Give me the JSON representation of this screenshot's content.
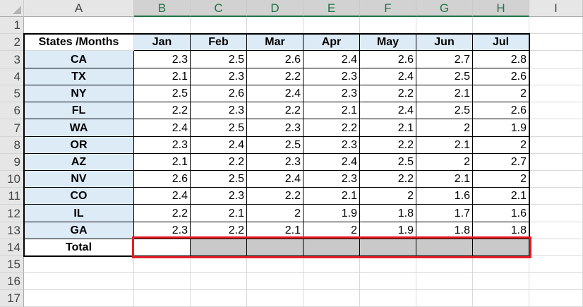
{
  "columns": [
    "A",
    "B",
    "C",
    "D",
    "E",
    "F",
    "G",
    "H",
    "I"
  ],
  "selected_columns": [
    "B",
    "C",
    "D",
    "E",
    "F",
    "G",
    "H"
  ],
  "rows": [
    "1",
    "2",
    "3",
    "4",
    "5",
    "6",
    "7",
    "8",
    "9",
    "10",
    "11",
    "12",
    "13",
    "14",
    "15",
    "16",
    "17"
  ],
  "table": {
    "corner_label": "States /Months",
    "months": [
      "Jan",
      "Feb",
      "Mar",
      "Apr",
      "May",
      "Jun",
      "Jul"
    ],
    "states": [
      "CA",
      "TX",
      "NY",
      "FL",
      "WA",
      "OR",
      "AZ",
      "NV",
      "CO",
      "IL",
      "GA"
    ],
    "values": [
      [
        "2.3",
        "2.5",
        "2.6",
        "2.4",
        "2.6",
        "2.7",
        "2.8"
      ],
      [
        "2.1",
        "2.3",
        "2.2",
        "2.3",
        "2.4",
        "2.5",
        "2.6"
      ],
      [
        "2.5",
        "2.6",
        "2.4",
        "2.3",
        "2.2",
        "2.1",
        "2"
      ],
      [
        "2.2",
        "2.3",
        "2.2",
        "2.1",
        "2.4",
        "2.5",
        "2.6"
      ],
      [
        "2.4",
        "2.5",
        "2.3",
        "2.2",
        "2.1",
        "2",
        "1.9"
      ],
      [
        "2.3",
        "2.4",
        "2.5",
        "2.3",
        "2.2",
        "2.1",
        "2"
      ],
      [
        "2.1",
        "2.2",
        "2.3",
        "2.4",
        "2.5",
        "2",
        "2.7"
      ],
      [
        "2.6",
        "2.5",
        "2.4",
        "2.3",
        "2.2",
        "2.1",
        "2"
      ],
      [
        "2.4",
        "2.3",
        "2.2",
        "2.1",
        "2",
        "1.6",
        "2.1"
      ],
      [
        "2.2",
        "2.1",
        "2",
        "1.9",
        "1.8",
        "1.7",
        "1.6"
      ],
      [
        "2.3",
        "2.2",
        "2.1",
        "2",
        "1.9",
        "1.8",
        "1.8"
      ]
    ],
    "total_label": "Total"
  },
  "colors": {
    "header_fill": "#ddebf7",
    "total_fill": "#c9c9c9",
    "highlight": "#e21f26",
    "selected_header": "#217346"
  }
}
